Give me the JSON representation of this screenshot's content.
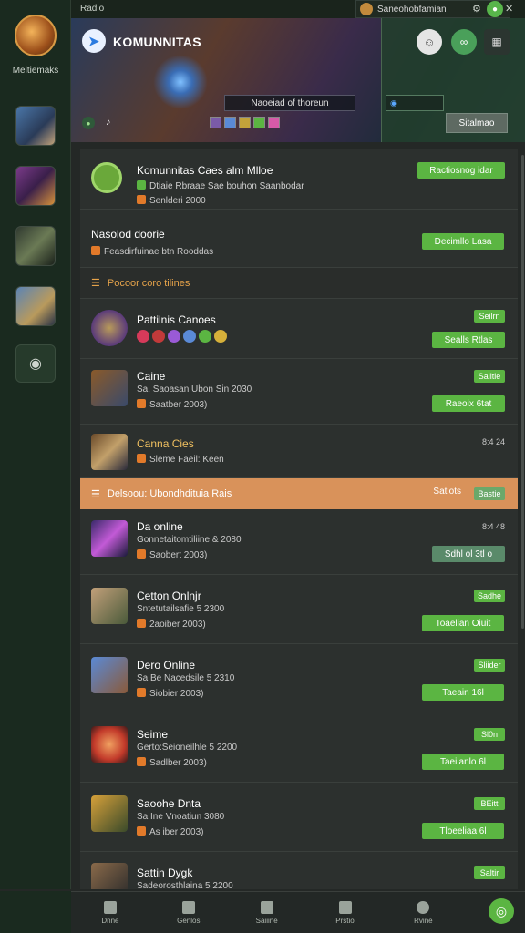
{
  "sidebar": {
    "user_label": "Meltiemaks",
    "games": [
      "game-1",
      "game-2",
      "game-3",
      "game-4"
    ],
    "add_icon": "camera-icon"
  },
  "topbar": {
    "title": "Radio",
    "username": "Saneohobfamian"
  },
  "banner": {
    "title": "KOMUNNITAS",
    "subtitle": "Naoeiad of thoreun",
    "status_button": "Sitalmao"
  },
  "groups": [
    {
      "title": "Komunnitas Caes alm Mlloe",
      "status": "Dtiaie Rbraae Sae bouhon Saanbodar",
      "sub": "Senlderi 2000",
      "button": "Ractiosnog idar"
    },
    {
      "title": "Nasolod doorie",
      "status": "",
      "sub": "Feasdirfuinae btn Rooddas",
      "button": "Decimllo Lasa"
    }
  ],
  "section1": "Pocoor coro tilines",
  "section2": {
    "label": "Delsoou: Ubondhdituia Rais",
    "right": "Satiots",
    "tag": "Bastie"
  },
  "chats": [
    {
      "title": "Pattilnis Canoes",
      "sub1": "",
      "sub2": "",
      "pill": "Seilrn",
      "button": "Sealls Rtlas"
    },
    {
      "title": "Caine",
      "sub1": "Sa. Saoasan Ubon Sin 2030",
      "sub2": "Saatber 2003)",
      "pill": "Saiitie",
      "button": "Raeoix 6tat"
    },
    {
      "title": "Canna Cies",
      "sub1": "Sleme Faeil: Keen",
      "sub2": "",
      "time": "8:4 24"
    },
    {
      "title": "Da online",
      "sub1": "Gonnetaitomtiliine & 2080",
      "sub2": "Saobert 2003)",
      "time": "8:4 48",
      "button": "Sdhl ol 3tl o"
    },
    {
      "title": "Cetton Onlnjr",
      "sub1": "Sntetutailsafie 5 2300",
      "sub2": "2aoiber 2003)",
      "pill": "Sadhe",
      "button": "Toaelian Oiuit"
    },
    {
      "title": "Dero Online",
      "sub1": "Sa Be Nacedsile 5 2310",
      "sub2": "Siobier 2003)",
      "pill": "Sliider",
      "button": "Taeain 16l"
    },
    {
      "title": "Seime",
      "sub1": "Gerto:Seioneilhle 5 2200",
      "sub2": "Sadlber 2003)",
      "pill": "Sl0n",
      "button": "Taeiianlo 6l"
    },
    {
      "title": "Saoohe Dnta",
      "sub1": "Sa Ine Vnoatiun 3080",
      "sub2": "As iber 2003)",
      "pill": "BEitt",
      "button": "Tloeeliaa 6l"
    },
    {
      "title": "Sattin Dygk",
      "sub1": "Sadeorosthlaina 5 2200",
      "sub2": "",
      "pill": "Saltir"
    }
  ],
  "nav": [
    "Dnne",
    "Genlos",
    "Saiiine",
    "Prstio",
    "Rvine"
  ],
  "colors": {
    "accent": "#5bb542",
    "section_highlight": "#d9925a",
    "orange": "#e27a2a"
  }
}
